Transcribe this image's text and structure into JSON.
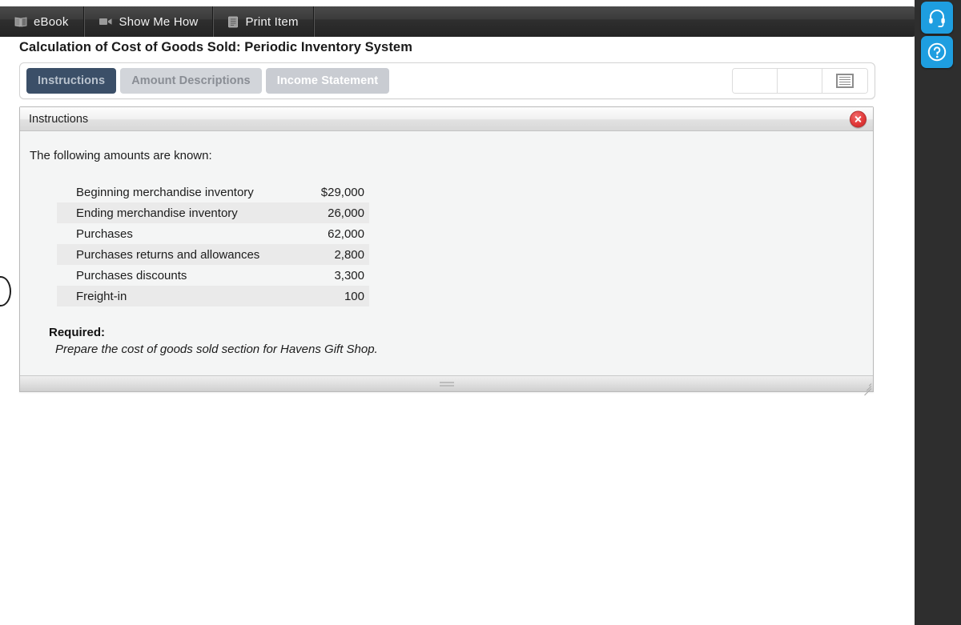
{
  "toolbar": {
    "buttons": [
      {
        "label": "eBook",
        "icon": "book-icon"
      },
      {
        "label": "Show Me How",
        "icon": "video-camera-icon"
      },
      {
        "label": "Print Item",
        "icon": "document-icon"
      }
    ]
  },
  "page_title": "Calculation of Cost of Goods Sold: Periodic Inventory System",
  "tabs": [
    {
      "label": "Instructions",
      "state": "active"
    },
    {
      "label": "Amount Descriptions",
      "state": "dim"
    },
    {
      "label": "Income Statement",
      "state": "light"
    }
  ],
  "minibar": {
    "slots": [
      "",
      "",
      "list-icon"
    ]
  },
  "window": {
    "title": "Instructions",
    "close_icon": "close-icon",
    "lead": "The following amounts are known:",
    "rows": [
      {
        "label": "Beginning merchandise inventory",
        "value": "$29,000"
      },
      {
        "label": "Ending merchandise inventory",
        "value": "26,000"
      },
      {
        "label": "Purchases",
        "value": "62,000"
      },
      {
        "label": "Purchases returns and allowances",
        "value": "2,800"
      },
      {
        "label": "Purchases discounts",
        "value": "3,300"
      },
      {
        "label": "Freight-in",
        "value": "100"
      }
    ],
    "required_label": "Required:",
    "required_text": "Prepare the cost of goods sold section for Havens Gift Shop."
  },
  "rail": {
    "support_icon": "headset-icon",
    "help_icon": "question-mark-icon"
  },
  "colors": {
    "accent_blue": "#1e9ee0",
    "tab_active": "#3b4f68",
    "close_red": "#e33a3a",
    "toolbar_dark": "#3b3b3b"
  }
}
